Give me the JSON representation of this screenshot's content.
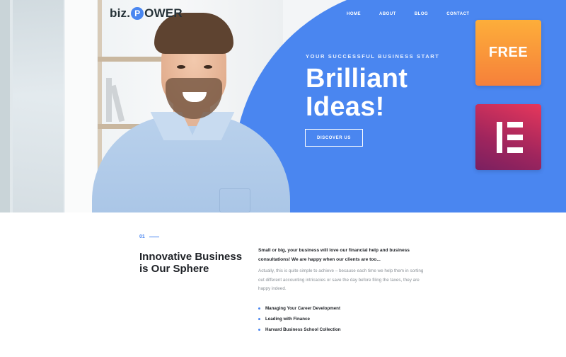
{
  "brand": {
    "prefix": "biz.",
    "badge_letter": "P",
    "suffix": "OWER"
  },
  "nav": {
    "items": [
      "HOME",
      "ABOUT",
      "BLOG",
      "CONTACT"
    ]
  },
  "hero": {
    "eyebrow": "YOUR SUCCESSFUL BUSINESS START",
    "headline_line1": "Brilliant",
    "headline_line2": "Ideas!",
    "cta": "DISCOVER US"
  },
  "badges": {
    "free": "FREE",
    "elementor_icon": "elementor-icon"
  },
  "section": {
    "number": "01",
    "title": "Innovative Business is Our Sphere",
    "lead": "Small or big, your business will love our financial help and business consultations! We are happy when our clients are too...",
    "body": "Actually, this is quite simple to achieve – because each time we help them in sorting out different accounting intricacies or save the day before filing the taxes, they are happy indeed.",
    "list": [
      "Managing Your Career Development",
      "Leading with Finance",
      "Harvard Business School Collection"
    ]
  },
  "colors": {
    "accent_blue": "#4a86f0",
    "free_badge": "#f89a3a",
    "elementor_badge": "#c2285c",
    "heading": "#1e2126"
  }
}
